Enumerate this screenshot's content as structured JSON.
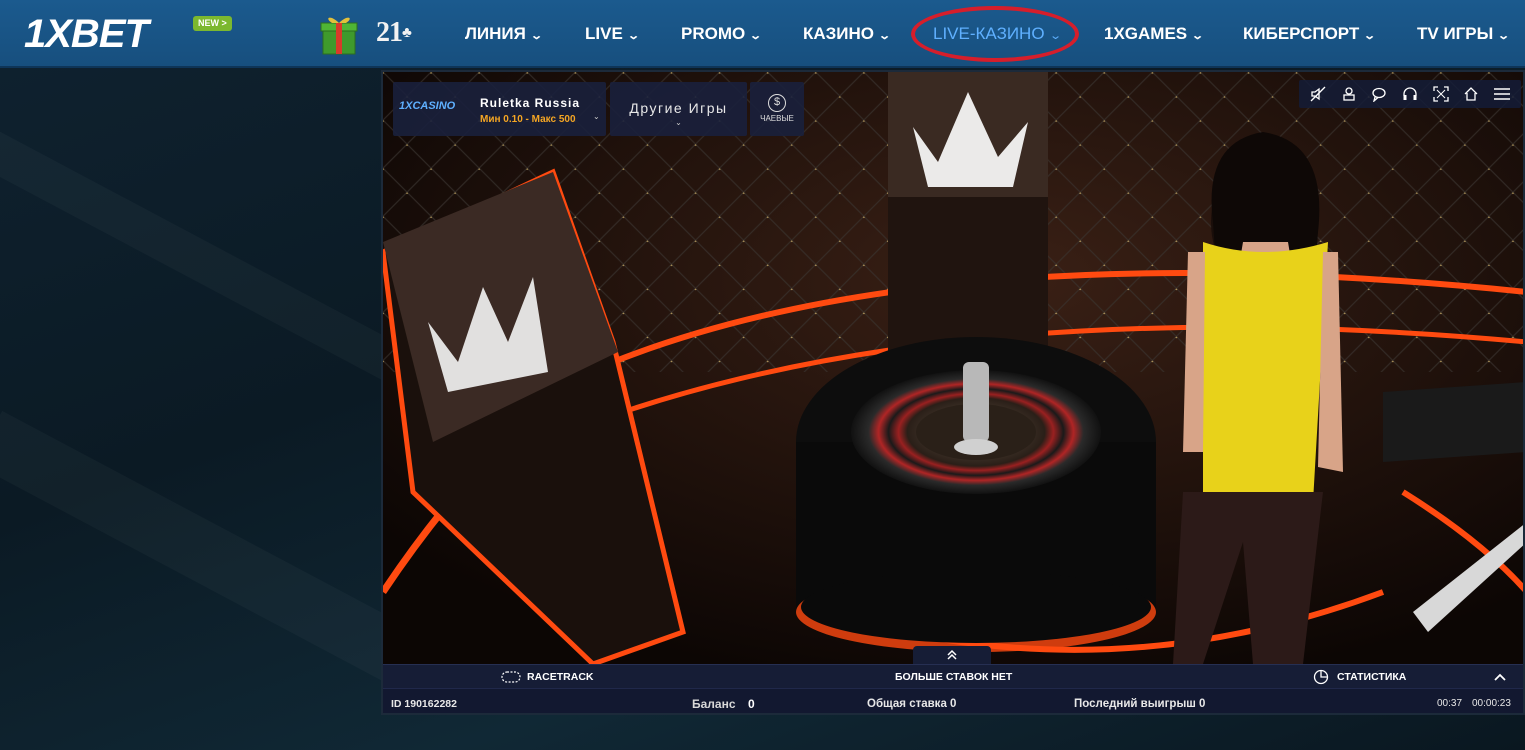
{
  "header": {
    "logo_text": "1XBET",
    "new_badge": "NEW >",
    "twentyone": "21",
    "nav": [
      {
        "label": "ЛИНИЯ"
      },
      {
        "label": "LIVE"
      },
      {
        "label": "PROMO"
      },
      {
        "label": "КАЗИНО"
      },
      {
        "label": "LIVE-КАЗИНО"
      },
      {
        "label": "1XGAMES"
      },
      {
        "label": "КИБЕРСПОРТ"
      },
      {
        "label": "TV ИГРЫ"
      }
    ],
    "active_nav": "LIVE-КАЗИНО"
  },
  "game": {
    "provider_logo": "1XCASINO",
    "table_name": "Ruletka Russia",
    "limits": "Мин 0.10 - Макс 500",
    "other_games_label": "Другие Игры",
    "tips_label": "ЧАЕВЫЕ",
    "toolbar_icons": [
      "mute-icon",
      "chips-icon",
      "chat-icon",
      "support-headset-icon",
      "fullscreen-icon",
      "home-icon",
      "menu-icon"
    ],
    "racetrack_label": "RACETRACK",
    "status_text": "БОЛЬШЕ СТАВОК НЕТ",
    "statistics_label": "СТАТИСТИКА",
    "round_id": "ID 190162282",
    "balance_label": "Баланс",
    "balance_value": "0",
    "total_bet": "Общая ставка 0",
    "last_win": "Последний выигрыш 0",
    "timer": "00:37",
    "session_time": "00:00:23"
  },
  "colors": {
    "header_bg": "#1b5a8e",
    "active_nav": "#5fb0ff",
    "highlight_ring": "#d61e2b",
    "new_badge": "#7cb82f",
    "limits": "#f5a623",
    "neon_orange": "#ff4a10",
    "dealer_dress": "#e8d21a"
  }
}
